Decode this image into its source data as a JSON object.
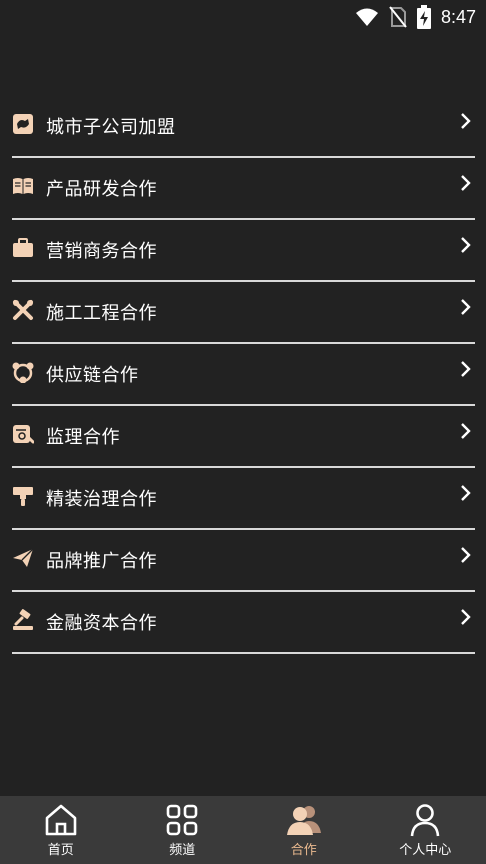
{
  "status_bar": {
    "time": "8:47",
    "icons": [
      "wifi-icon",
      "no-sim-icon",
      "battery-charging-icon"
    ]
  },
  "colors": {
    "background": "#222222",
    "divider": "#d9d9d9",
    "icon_accent": "#f3d2b6",
    "nav_background": "#3a3a3a",
    "nav_active": "#e9b98f"
  },
  "menu": {
    "items": [
      {
        "label": "城市子公司加盟",
        "icon": "city-franchise-icon"
      },
      {
        "label": "产品研发合作",
        "icon": "open-book-icon"
      },
      {
        "label": "营销商务合作",
        "icon": "briefcase-icon"
      },
      {
        "label": "施工工程合作",
        "icon": "tools-icon"
      },
      {
        "label": "供应链合作",
        "icon": "network-icon"
      },
      {
        "label": "监理合作",
        "icon": "inspection-icon"
      },
      {
        "label": "精装治理合作",
        "icon": "paint-roller-icon"
      },
      {
        "label": "品牌推广合作",
        "icon": "paper-plane-icon"
      },
      {
        "label": "金融资本合作",
        "icon": "gavel-icon"
      }
    ]
  },
  "bottom_nav": {
    "items": [
      {
        "label": "首页",
        "icon": "home-icon"
      },
      {
        "label": "频道",
        "icon": "grid-icon"
      },
      {
        "label": "合作",
        "icon": "users-icon",
        "active": true
      },
      {
        "label": "个人中心",
        "icon": "person-icon"
      }
    ]
  }
}
